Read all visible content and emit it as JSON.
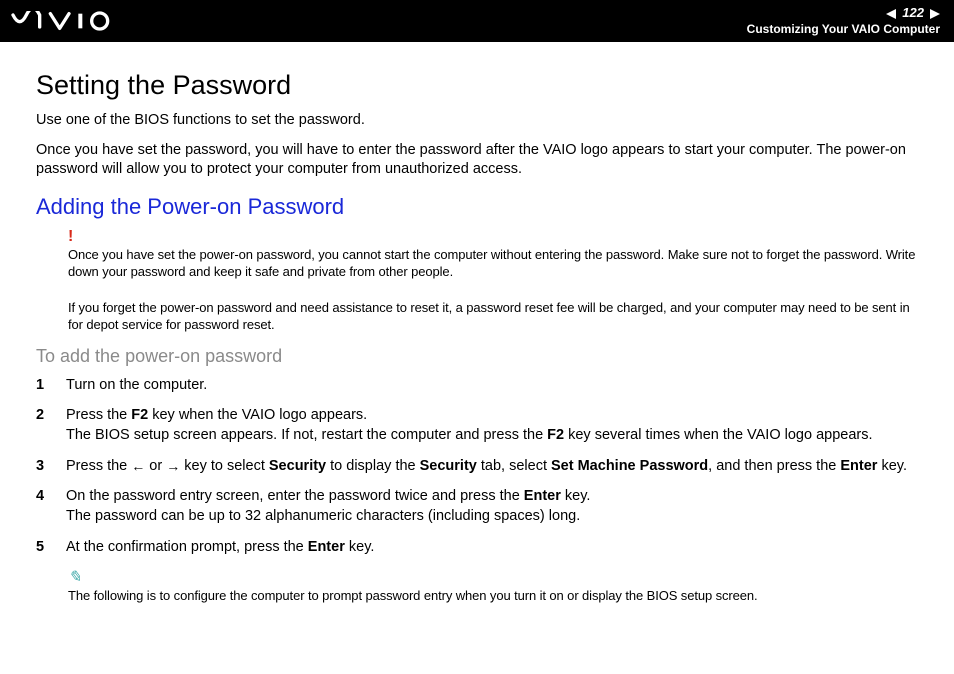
{
  "header": {
    "page_number": "122",
    "breadcrumb": "Customizing Your VAIO Computer"
  },
  "title": "Setting the Password",
  "intro1": "Use one of the BIOS functions to set the password.",
  "intro2": "Once you have set the password, you will have to enter the password after the VAIO logo appears to start your computer. The power-on password will allow you to protect your computer from unauthorized access.",
  "section_blue": "Adding the Power-on Password",
  "warn1": "Once you have set the power-on password, you cannot start the computer without entering the password. Make sure not to forget the password. Write down your password and keep it safe and private from other people.",
  "warn2": "If you forget the power-on password and need assistance to reset it, a password reset fee will be charged, and your computer may need to be sent in for depot service for password reset.",
  "section_grey": "To add the power-on password",
  "steps": {
    "s1": "Turn on the computer.",
    "s2a": "Press the ",
    "s2_key1": "F2",
    "s2b": " key when the VAIO logo appears.",
    "s2c": "The BIOS setup screen appears. If not, restart the computer and press the ",
    "s2_key2": "F2",
    "s2d": " key several times when the VAIO logo appears.",
    "s3a": "Press the ",
    "s3b": " or ",
    "s3c": " key to select ",
    "s3_k1": "Security",
    "s3d": " to display the ",
    "s3_k2": "Security",
    "s3e": " tab, select ",
    "s3_k3": "Set Machine Password",
    "s3f": ", and then press the ",
    "s3_k4": "Enter",
    "s3g": " key.",
    "s4a": "On the password entry screen, enter the password twice and press the ",
    "s4_k1": "Enter",
    "s4b": " key.",
    "s4c": "The password can be up to 32 alphanumeric characters (including spaces) long.",
    "s5a": "At the confirmation prompt, press the ",
    "s5_k1": "Enter",
    "s5b": " key."
  },
  "note": "The following is to configure the computer to prompt password entry when you turn it on or display the BIOS setup screen."
}
